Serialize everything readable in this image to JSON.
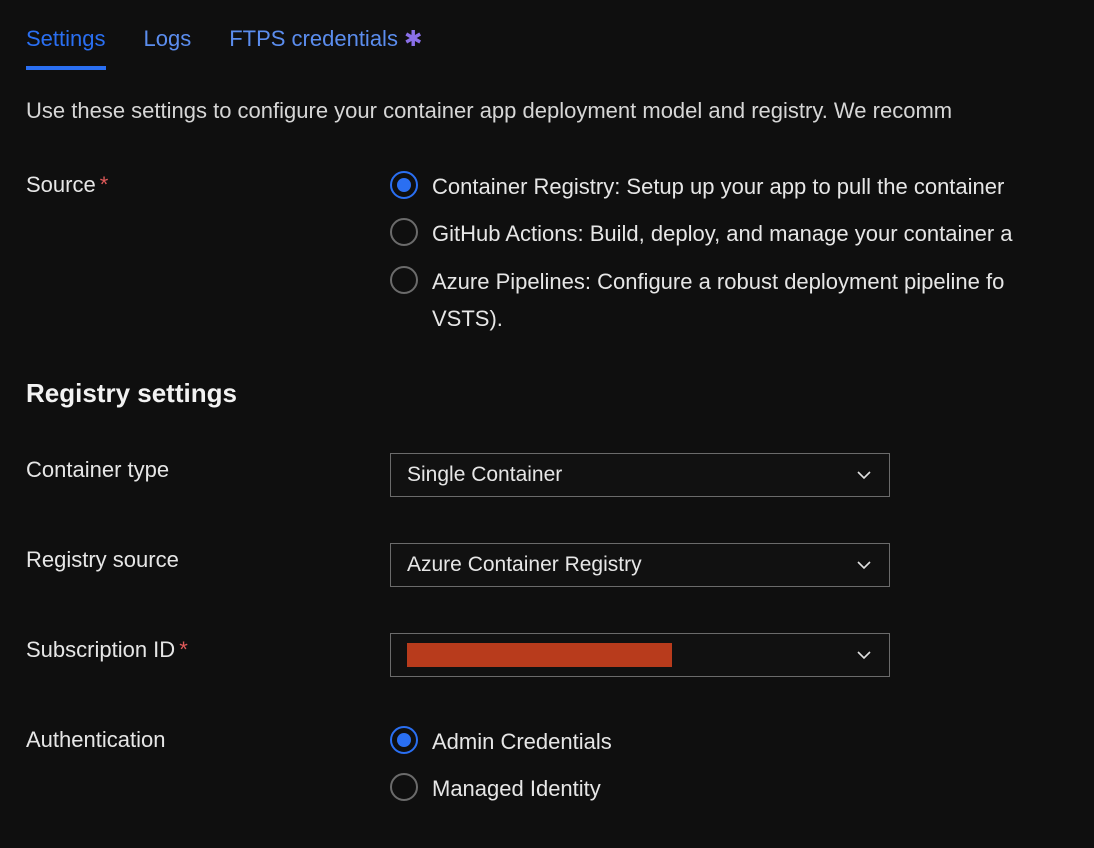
{
  "tabs": {
    "settings": "Settings",
    "logs": "Logs",
    "ftps": "FTPS credentials"
  },
  "description": "Use these settings to configure your container app deployment model and registry. We recomm",
  "source": {
    "label": "Source",
    "options": {
      "container_registry": "Container Registry: Setup up your app to pull the container",
      "github_actions": "GitHub Actions: Build, deploy, and manage your container a",
      "azure_pipelines": "Azure Pipelines: Configure a robust deployment pipeline fo",
      "azure_pipelines_line2": "VSTS)."
    }
  },
  "registry_heading": "Registry settings",
  "container_type": {
    "label": "Container type",
    "value": "Single Container"
  },
  "registry_source": {
    "label": "Registry source",
    "value": "Azure Container Registry"
  },
  "subscription_id": {
    "label": "Subscription ID"
  },
  "authentication": {
    "label": "Authentication",
    "options": {
      "admin": "Admin Credentials",
      "managed": "Managed Identity"
    }
  }
}
